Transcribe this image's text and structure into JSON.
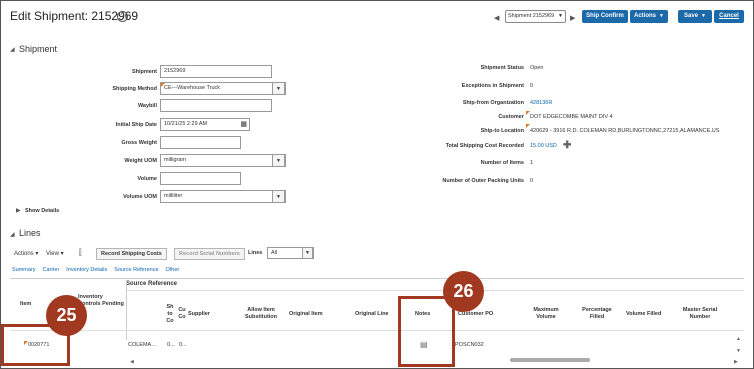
{
  "header": {
    "title": "Edit Shipment: 2152969",
    "shipment_select": "Shipment 2152969",
    "ship_confirm": "Ship Confirm",
    "actions": "Actions",
    "save": "Save",
    "cancel": "Cancel"
  },
  "shipment_section": {
    "title": "Shipment",
    "fields": {
      "shipment_label": "Shipment",
      "shipment_value": "2152969",
      "method_label": "Shipping Method",
      "method_value": "CE---Warehouse Truck",
      "waybill_label": "Waybill",
      "ship_date_label": "Initial Ship Date",
      "ship_date_value": "10/21/25 2:29 AM",
      "gross_label": "Gross Weight",
      "weight_uom_label": "Weight UOM",
      "weight_uom_value": "milligram",
      "volume_label": "Volume",
      "volume_uom_label": "Volume UOM",
      "volume_uom_value": "milliliter"
    },
    "right": {
      "status_label": "Shipment Status",
      "status_value": "Open",
      "exceptions_label": "Exceptions in Shipment",
      "exceptions_value": "0",
      "shipfrom_label": "Ship-from Organization",
      "shipfrom_value": "428136R",
      "customer_label": "Customer",
      "customer_value": "DOT EDGECOMBE MAINT DIV 4",
      "shipto_label": "Ship-to Location",
      "shipto_value": "420629 - 3916 R.D. COLEMAN RD,BURLINGTONNC,27215,ALAMANCE,US",
      "cost_label": "Total Shipping Cost Recorded",
      "cost_value": "15.00 USD",
      "items_label": "Number of Items",
      "items_value": "1",
      "packing_label": "Number of Outer Packing Units",
      "packing_value": "0"
    },
    "show_details": "Show Details"
  },
  "lines_section": {
    "title": "Lines",
    "actions": "Actions",
    "view": "View",
    "record_costs": "Record Shipping Costs",
    "record_serials": "Record Serial Numbers",
    "lines_label": "Lines",
    "lines_value": "All",
    "tabs": [
      "Summary",
      "Carrier",
      "Inventory Details",
      "Source Reference",
      "Other"
    ],
    "group_header": "Source Reference",
    "columns": {
      "item": "Item",
      "inv_controls": "Inventory Controls Pending",
      "ship_to": "Sh to Co",
      "cu": "Cu Co",
      "supplier": "Supplier",
      "allow_sub": "Allow Item Substitution",
      "orig_item": "Original Item",
      "orig_line": "Original Line",
      "notes": "Notes",
      "customer_po": "Customer PO",
      "max_volume": "Maximum Volume",
      "pct_filled": "Percentage Filled",
      "vol_filled": "Volume Filled",
      "master_serial": "Master Serial Number"
    },
    "row": {
      "item": "0020771",
      "src": "COLEMA...",
      "sh": "0...",
      "cu": "0...",
      "customer_po": "POSCN032"
    }
  },
  "callouts": {
    "left": "25",
    "right": "26"
  },
  "colors": {
    "accent": "#1d6aaa",
    "callout": "#a0391f",
    "link": "#0b64b0"
  }
}
